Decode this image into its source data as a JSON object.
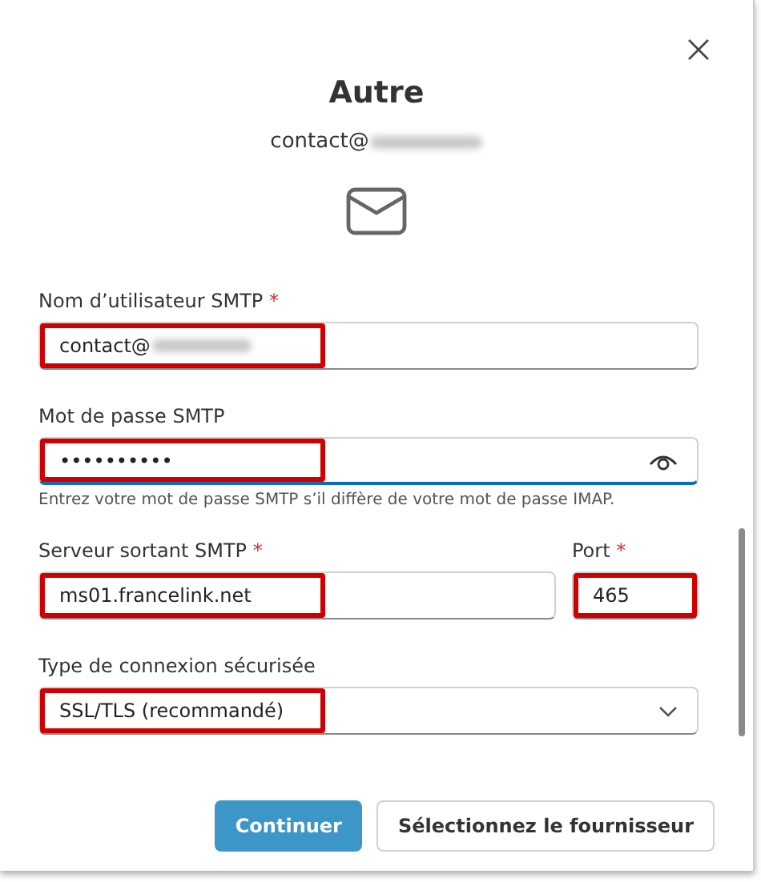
{
  "dialog": {
    "title": "Autre",
    "account": {
      "text": "contact@",
      "redacted": true
    }
  },
  "fields": [
    {
      "kind": "text",
      "label": "Nom d’utilisateur SMTP",
      "required_mark": "*",
      "value": "contact@",
      "redacted": true,
      "focused": false,
      "highlighted": true
    },
    {
      "kind": "password",
      "label": "Mot de passe SMTP",
      "value": "••••••••••",
      "focused": true,
      "highlighted": true,
      "hint": "Entrez votre mot de passe SMTP s’il diffère de votre mot de passe IMAP."
    },
    {
      "kind": "pair",
      "items": [
        {
          "label": "Serveur sortant SMTP",
          "required_mark": "*",
          "value": "ms01.francelink.net",
          "highlighted": true
        },
        {
          "label": "Port",
          "required_mark": "*",
          "value": "465",
          "highlighted": true
        }
      ]
    },
    {
      "kind": "select",
      "label": "Type de connexion sécurisée",
      "value": "SSL/TLS (recommandé)",
      "focused": false,
      "highlighted": true
    }
  ],
  "buttons": [
    {
      "label": "Continuer",
      "primary": true
    },
    {
      "label": "Sélectionnez le fournisseur",
      "primary": false
    }
  ]
}
